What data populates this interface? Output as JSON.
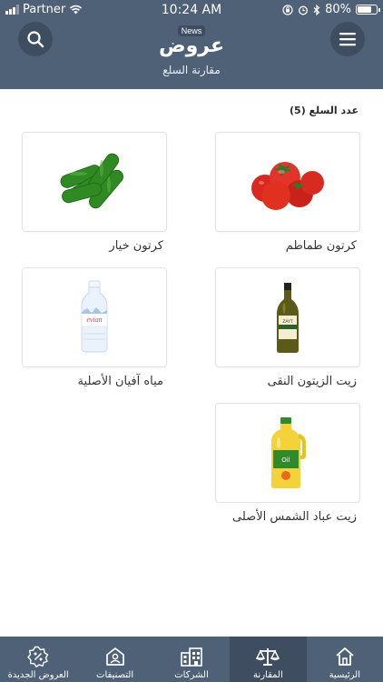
{
  "status": {
    "carrier": "Partner",
    "time": "10:24 AM",
    "battery": "80%",
    "battery_level": 0.8
  },
  "header": {
    "badge": "News",
    "logo": "عروض",
    "subtitle": "مقارنة السلع"
  },
  "content": {
    "count_label": "عدد السلع (5)",
    "products": [
      {
        "name": "كرتون طماطم",
        "icon": "tomatoes-image"
      },
      {
        "name": "كرتون خيار",
        "icon": "cucumbers-image"
      },
      {
        "name": "زيت الزيتون النقى",
        "icon": "olive-oil-bottle-image"
      },
      {
        "name": "مياه آفيان الأصلية",
        "icon": "evian-water-bottle-image"
      },
      {
        "name": "زيت عباد الشمس الأصلى",
        "icon": "sunflower-oil-bottle-image"
      }
    ],
    "evian_label": "evian",
    "olive_label": "ZAYT",
    "sunflower_label": "Oil"
  },
  "tabs": [
    {
      "label": "الرئيسية",
      "icon": "home-icon",
      "active": false
    },
    {
      "label": "المقارنة",
      "icon": "scale-icon",
      "active": true
    },
    {
      "label": "الشركات",
      "icon": "buildings-icon",
      "active": false
    },
    {
      "label": "التصنيفات",
      "icon": "categories-icon",
      "active": false
    },
    {
      "label": "العروض الجديدة",
      "icon": "new-offer-badge-icon",
      "active": false
    }
  ],
  "colors": {
    "header": "#4f6176",
    "header_dark": "#3e4e60"
  }
}
